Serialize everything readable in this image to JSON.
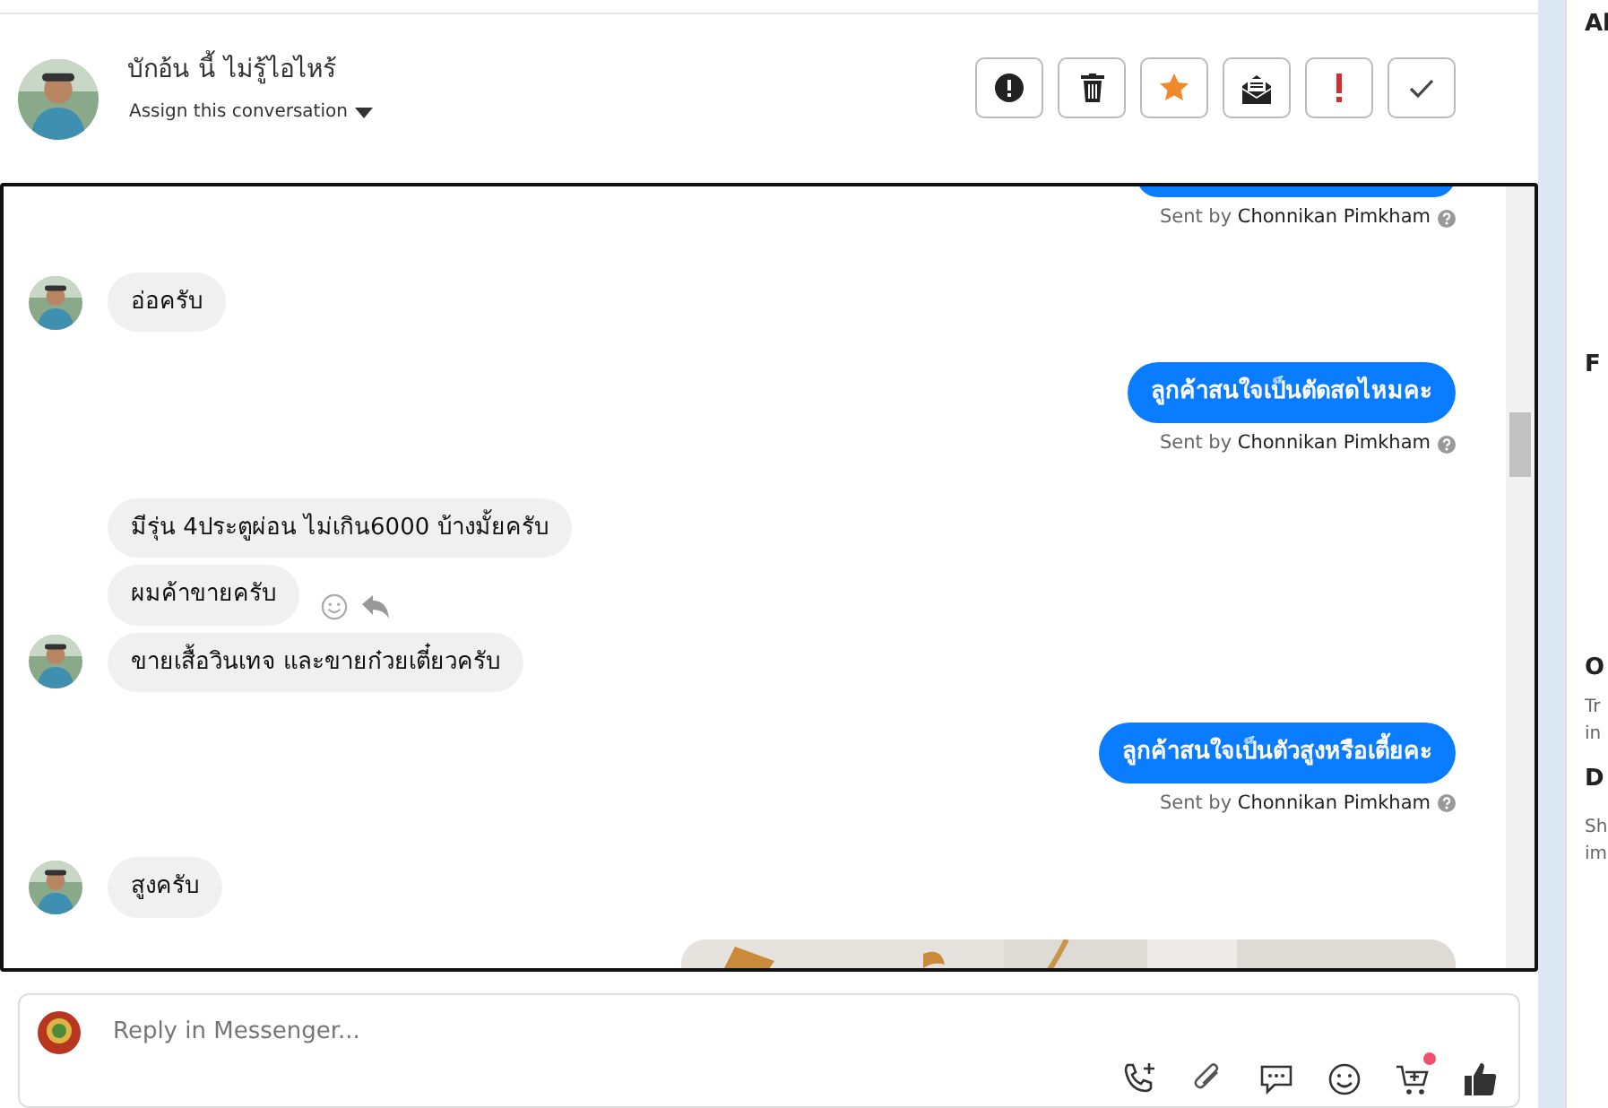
{
  "header": {
    "name": "บักอ้น นี้ ไม่รู้ไอไหร้",
    "assign": "Assign this conversation"
  },
  "toolbar": [
    {
      "kind": "alert"
    },
    {
      "kind": "trash"
    },
    {
      "kind": "star"
    },
    {
      "kind": "mail"
    },
    {
      "kind": "exclaim"
    },
    {
      "kind": "check"
    }
  ],
  "messages": [
    {
      "kind": "out",
      "cut": true,
      "sent_by_label": "Sent by",
      "sent_by": "Chonnikan Pimkham"
    },
    {
      "kind": "in",
      "text": "อ่อครับ",
      "avatar": true
    },
    {
      "kind": "out",
      "text": "ลูกค้าสนใจเป็นตัดสดไหมคะ",
      "sent_by_label": "Sent by",
      "sent_by": "Chonnikan Pimkham"
    },
    {
      "kind": "in",
      "text": "มีรุ่น 4ประตูผ่อน ไม่เกิน6000 บ้างมั้ยครับ",
      "avatar": false
    },
    {
      "kind": "in",
      "text": "ผมค้าขายครับ",
      "avatar": false,
      "actions": true
    },
    {
      "kind": "in",
      "text": "ขายเสื้อวินเทจ และขายก๋วยเตี๋ยวครับ",
      "avatar": true
    },
    {
      "kind": "out",
      "text": "ลูกค้าสนใจเป็นตัวสูงหรือเตี้ยคะ",
      "sent_by_label": "Sent by",
      "sent_by": "Chonnikan Pimkham"
    },
    {
      "kind": "in",
      "text": "สูงครับ",
      "avatar": true
    },
    {
      "image": {
        "kind": "picture"
      }
    }
  ],
  "composer": {
    "placeholder": "Reply in Messenger...",
    "tools": [
      {
        "kind": "call"
      },
      {
        "kind": "attach"
      },
      {
        "kind": "chat"
      },
      {
        "kind": "emoji"
      },
      {
        "kind": "cart",
        "notify": true
      },
      {
        "kind": "like"
      }
    ]
  },
  "side_panel": [
    {
      "kind": "head",
      "text": "Al"
    },
    {
      "kind": "head",
      "text": "F"
    },
    {
      "kind": "head",
      "text": "O"
    },
    {
      "kind": "text",
      "text": "Tr"
    },
    {
      "kind": "text",
      "text": "in"
    },
    {
      "kind": "head",
      "text": "D"
    },
    {
      "kind": "text",
      "text": "Sh"
    },
    {
      "kind": "text",
      "text": "im"
    }
  ]
}
